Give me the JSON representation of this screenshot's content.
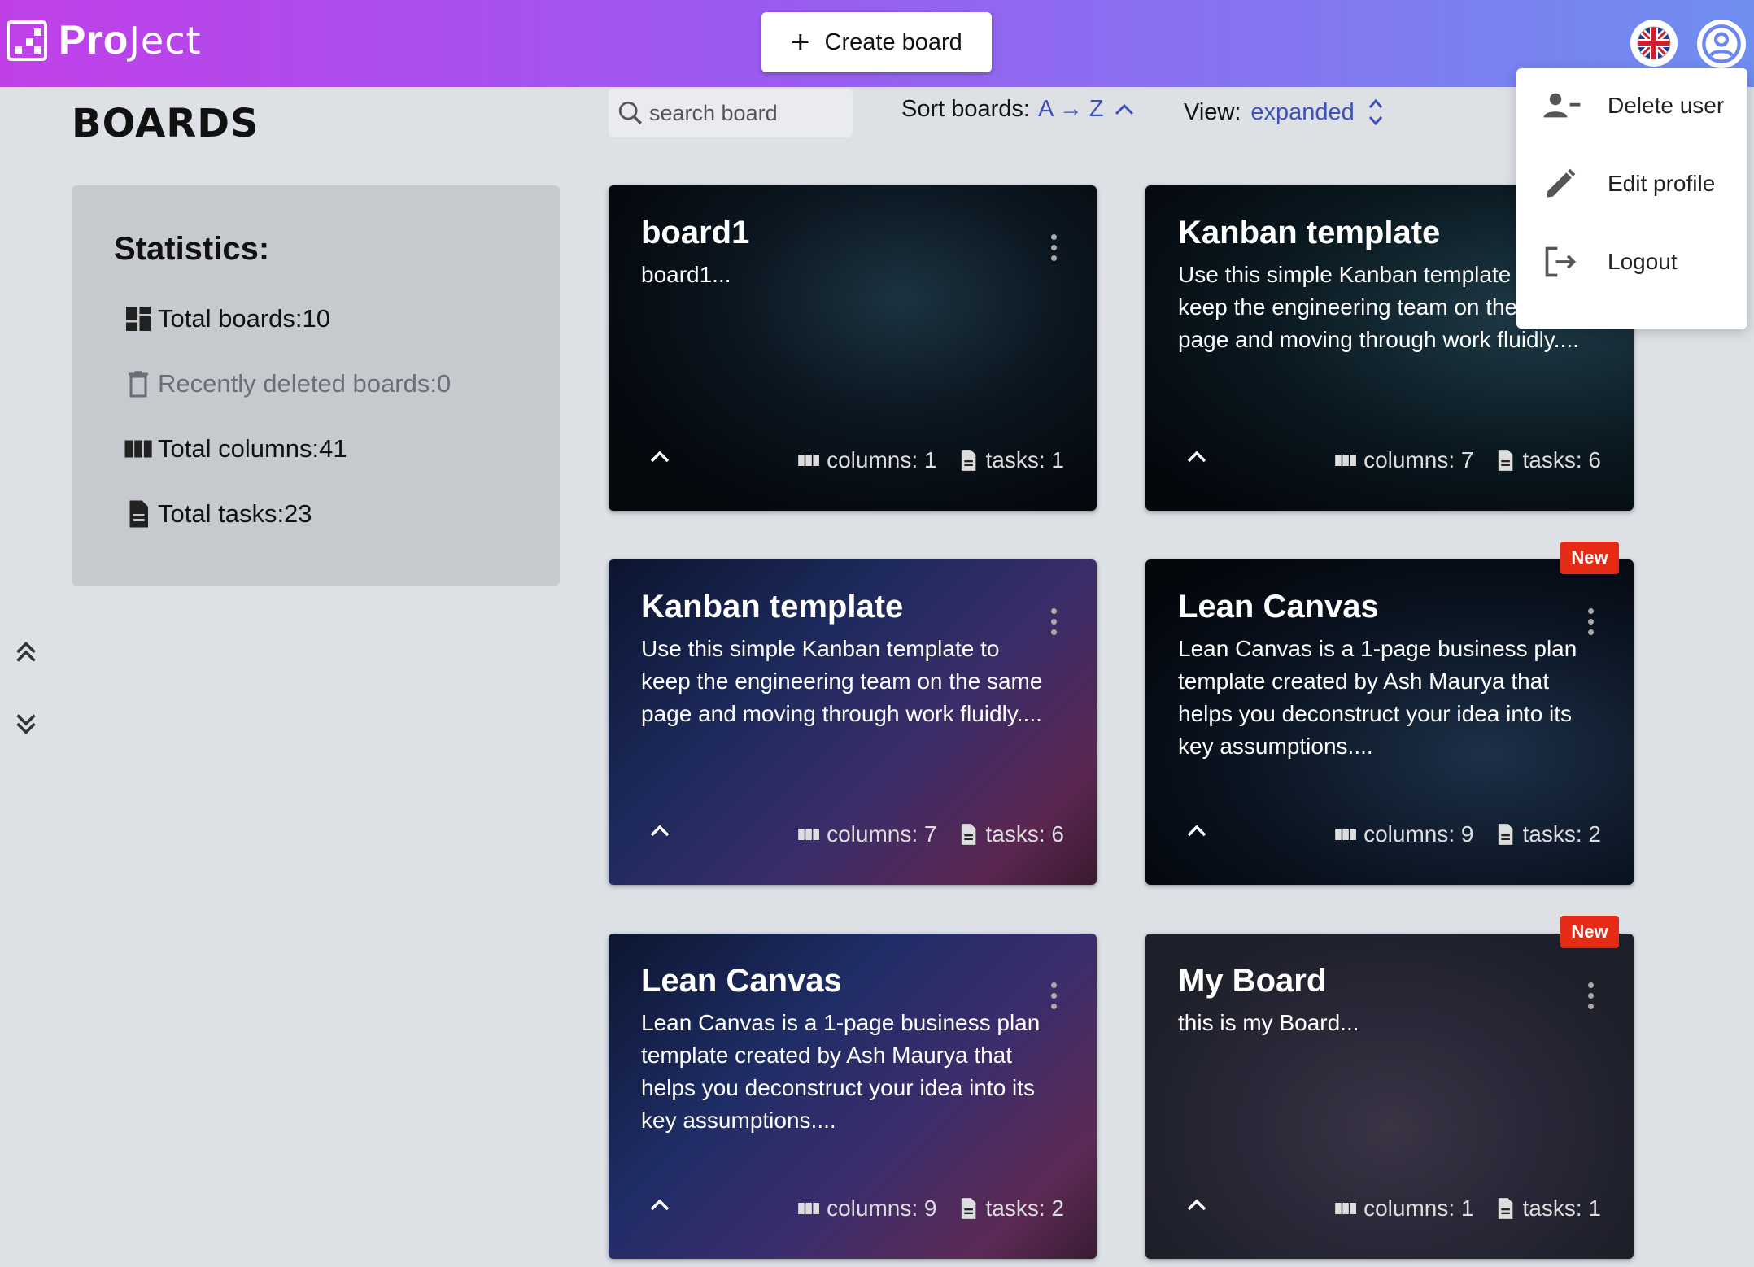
{
  "header": {
    "logo_bold": "Pro",
    "logo_light": "Ject",
    "create_board_label": "Create board",
    "language_icon": "uk-flag-icon",
    "profile_icon": "account-circle-icon"
  },
  "toolbar": {
    "page_title": "BOARDS",
    "search_placeholder": "search board",
    "sort_label": "Sort boards:",
    "sort_value": "A → Z",
    "view_label": "View:",
    "view_value": "expanded"
  },
  "stats": {
    "heading": "Statistics:",
    "total_boards": "Total boards:10",
    "recently_deleted": "Recently deleted boards:0",
    "total_columns": "Total columns:41",
    "total_tasks": "Total tasks:23"
  },
  "boards": [
    {
      "title": "board1",
      "desc": "board1...",
      "columns": "columns: 1",
      "tasks": "tasks: 1",
      "badge": ""
    },
    {
      "title": "Kanban template",
      "desc": "Use this simple Kanban template to keep the engineering team on the same page and moving through work fluidly....",
      "columns": "columns: 7",
      "tasks": "tasks: 6",
      "badge": ""
    },
    {
      "title": "Kanban template",
      "desc": "Use this simple Kanban template to keep the engineering team on the same page and moving through work fluidly....",
      "columns": "columns: 7",
      "tasks": "tasks: 6",
      "badge": ""
    },
    {
      "title": "Lean Canvas",
      "desc": "Lean Canvas is a 1-page business plan template created by Ash Maurya that helps you deconstruct your idea into its key assumptions....",
      "columns": "columns: 9",
      "tasks": "tasks: 2",
      "badge": "New"
    },
    {
      "title": "Lean Canvas",
      "desc": "Lean Canvas is a 1-page business plan template created by Ash Maurya that helps you deconstruct your idea into its key assumptions....",
      "columns": "columns: 9",
      "tasks": "tasks: 2",
      "badge": ""
    },
    {
      "title": "My Board",
      "desc": "this is my Board...",
      "columns": "columns: 1",
      "tasks": "tasks: 1",
      "badge": "New"
    }
  ],
  "user_menu": {
    "delete_user": "Delete user",
    "edit_profile": "Edit profile",
    "logout": "Logout"
  },
  "colors": {
    "header_gradient_start": "#c040e8",
    "header_gradient_end": "#6f8ef0",
    "accent": "#3f51b5",
    "badge": "#e52a16"
  }
}
